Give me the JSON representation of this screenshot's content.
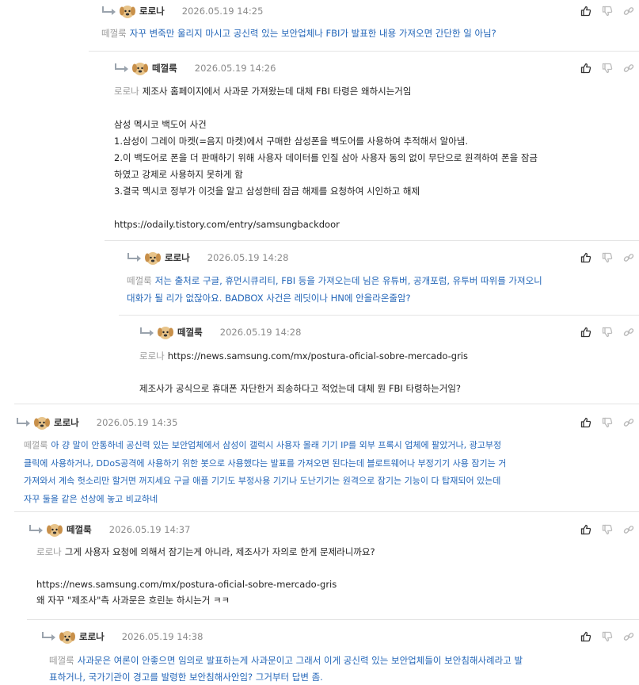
{
  "icons": {
    "reply_arrow": "reply-arrow-icon",
    "avatar": "puppy-avatar-icon",
    "like": "thumbs-up-icon",
    "dislike": "thumbs-down-icon",
    "link": "link-icon"
  },
  "colors": {
    "reply_text_blue": "#2366b8",
    "mention_gray": "#9a9a9a",
    "date_gray": "#8a8a8a"
  },
  "comments": [
    {
      "author": "로로나",
      "date": "2026.05.19 14:25",
      "mention": "떼껄룩",
      "lines": [
        "자꾸 변죽만 울리지 마시고 공신력 있는 보안업체나 FBI가 발표한 내용 가져오면 간단한 일 아님?"
      ]
    },
    {
      "author": "떼껄룩",
      "date": "2026.05.19 14:26",
      "mention": "로로나",
      "lines": [
        "제조사 홈페이지에서 사과문 가져왔는데 대체 FBI 타령은 왜하시는거임",
        "",
        "삼성 멕시코 백도어 사건",
        "1.삼성이 그레이 마켓(=음지 마켓)에서 구매한 삼성폰을 백도어를 사용하여 추적해서 알아냄.",
        "2.이 백도어로 폰을 더 판매하기 위해 사용자 데이터를 인질 삼아 사용자 동의 없이 무단으로 원격하여 폰을 잠금",
        "하였고 강제로 사용하지 못하게 함",
        "3.결국 멕시코 정부가 이것을 알고 삼성한테 잠금 해제를 요청하여 시인하고 해제",
        "",
        "https://odaily.tistory.com/entry/samsungbackdoor"
      ]
    },
    {
      "author": "로로나",
      "date": "2026.05.19 14:28",
      "mention": "떼껄룩",
      "lines": [
        "저는 출처로 구글, 휴먼시큐리티, FBI 등을 가져오는데 님은 유튜버, 공개포럼, 유투버 따위를 가져오니",
        "대화가 될 리가 없잖아요. BADBOX 사건은 레딧이나 HN에 안올라온줄암?"
      ]
    },
    {
      "author": "떼껄룩",
      "date": "2026.05.19 14:28",
      "mention": "로로나",
      "lines": [
        "https://news.samsung.com/mx/postura-oficial-sobre-mercado-gris",
        "",
        "제조사가 공식으로 휴대폰 자단한거 죄송하다고 적었는데 대체 뭔 FBI 타령하는거임?"
      ]
    },
    {
      "author": "로로나",
      "date": "2026.05.19 14:35",
      "mention": "떼껄룩",
      "lines": [
        "아 걍 말이 안통하네 공신력 있는 보안업체에서 삼성이 갤럭시 사용자 몰래 기기 IP를 외부 프록시 업체에 팔았거나, 광고부정",
        "클릭에 사용하거나, DDoS공격에 사용하기 위한 봇으로 사용했다는 발표를 가져오면 된다는데 블로트웨어나 부정기기 사용 잠기는 거",
        "가져와서 계속 헛소리만 할거면 꺼지세요 구글 애플 기기도 부정사용 기기나 도난기기는 원격으로 잠기는 기능이 다 탑재되어 있는데",
        "자꾸 둘을 같은 선상에 놓고 비교하네"
      ]
    },
    {
      "author": "떼껄룩",
      "date": "2026.05.19 14:37",
      "mention": "로로나",
      "lines": [
        "그게 사용자 요청에 의해서 잠기는게 아니라, 제조사가 자의로 한게 문제라니까요?",
        "",
        "https://news.samsung.com/mx/postura-oficial-sobre-mercado-gris",
        "왜 자꾸 \"제조사\"측 사과문은 흐린눈 하시는거 ㅋㅋ"
      ]
    },
    {
      "author": "로로나",
      "date": "2026.05.19 14:38",
      "mention": "떼껄룩",
      "lines": [
        "사과문은 여론이 안좋으면 임의로 발표하는게 사과문이고 그래서 이게 공신력 있는 보안업체들이 보안침해사례라고 발",
        "표하거나, 국가기관이 경고를 발령한 보안침해사안임? 그거부터 답변 좀."
      ]
    }
  ]
}
